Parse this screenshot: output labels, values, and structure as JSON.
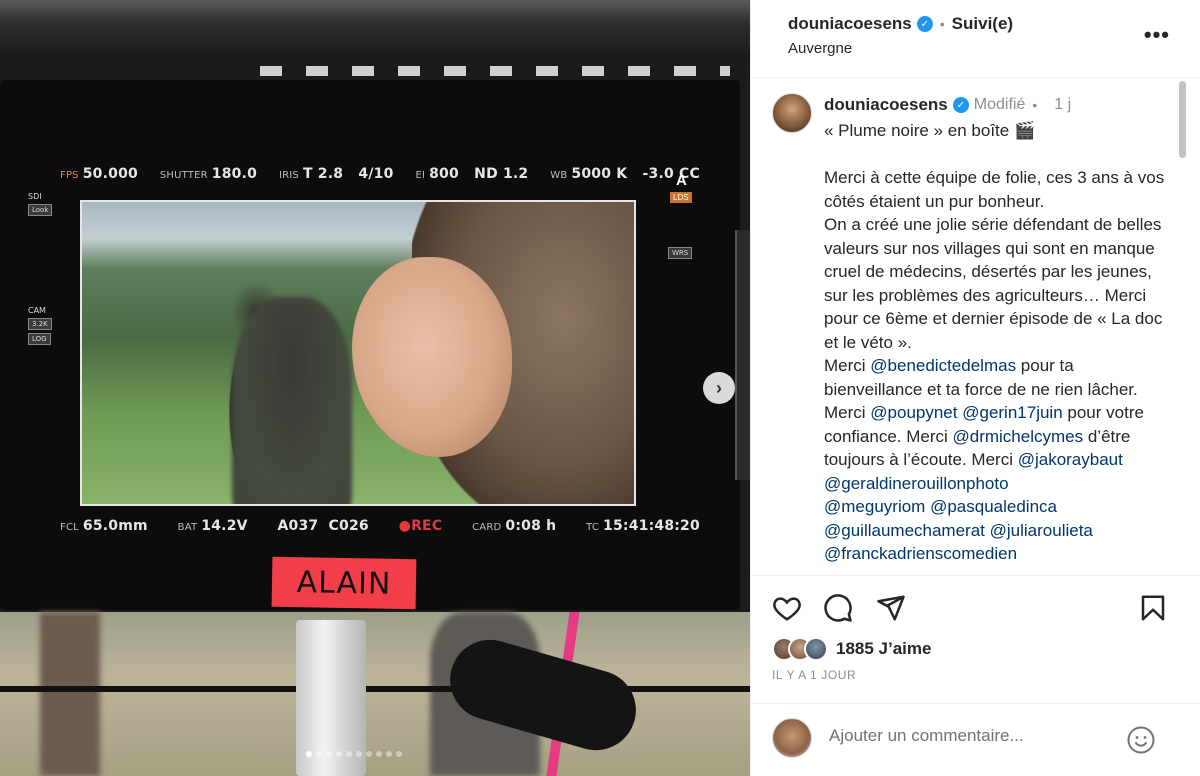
{
  "post": {
    "username": "douniacoesens",
    "verified_mark": "✓",
    "separator": "•",
    "follow_status": "Suivi(e)",
    "location": "Auvergne",
    "more_icon": "•••"
  },
  "media": {
    "hud_top": [
      {
        "key": "FPS",
        "value": "50.000"
      },
      {
        "key": "SHUTTER",
        "value": "180.0"
      },
      {
        "key": "IRIS",
        "value": "T 2.8   4/10"
      },
      {
        "key": "EI",
        "value": "800   ND 1.2"
      },
      {
        "key": "WB",
        "value": "5000 K   -3.0 CC"
      }
    ],
    "hud_bottom": [
      {
        "key": "FCL",
        "value": "65.0mm"
      },
      {
        "key": "BAT",
        "value": "14.2V"
      },
      {
        "key": "",
        "value": "A037  C026"
      },
      {
        "key": "",
        "value": "●REC"
      },
      {
        "key": "CARD",
        "value": "0:08 h"
      },
      {
        "key": "TC",
        "value": "15:41:48:20"
      }
    ],
    "badge_a": "A",
    "badge_lds": "LDS",
    "sdi_label": "SDI",
    "sdi_box": "Look",
    "cam_label": "CAM",
    "cam_box1": "3.2K",
    "cam_box2": "LOG",
    "wrs_label": "WRS",
    "tape_label": "ALAIN",
    "next_icon": "›",
    "carousel": {
      "count": 10,
      "active_index": 0
    }
  },
  "caption": {
    "username": "douniacoesens",
    "edited": "Modifié",
    "separator": "•",
    "time_ago": "1 j",
    "line_title": "« Plume noire » en boîte 🎬",
    "body_1": "Merci à cette équipe de folie, ces 3 ans à vos côtés étaient un pur bonheur.",
    "body_2": "On a créé une jolie série défendant de belles valeurs sur nos villages qui sont en manque cruel de médecins, désertés par les jeunes, sur les problèmes des agriculteurs… Merci pour ce 6ème et dernier épisode de « La doc et le véto ».",
    "merci_1": "Merci ",
    "mention_1": "@benedictedelmas",
    "text_1": " pour ta bienveillance et ta force de ne rien lâcher. Merci ",
    "mention_2": "@poupynet",
    "mention_3": "@gerin17juin",
    "text_2": " pour votre confiance. Merci ",
    "mention_4": "@drmichelcymes",
    "text_3": " d’être toujours à l’écoute. Merci ",
    "mention_5": "@jakoraybaut",
    "mention_6": "@geraldinerouillonphoto",
    "mention_7": "@meguyriom",
    "mention_8": "@pasqualedinca",
    "mention_9": "@guillaumechamerat",
    "mention_10": "@juliaroulieta",
    "mention_11": "@franckadrienscomedien"
  },
  "actions": {
    "likes": "1885 J’aime",
    "date": "IL Y A 1 JOUR"
  },
  "comment": {
    "placeholder": "Ajouter un commentaire..."
  },
  "colors": {
    "verified": "#1f96f2",
    "mention": "#00376b",
    "tape": "#f23d4a",
    "rec": "#e03a3a"
  },
  "icons": [
    "heart-icon",
    "comment-icon",
    "share-icon",
    "bookmark-icon",
    "emoji-icon",
    "chevron-right-icon",
    "more-icon",
    "verified-icon"
  ]
}
